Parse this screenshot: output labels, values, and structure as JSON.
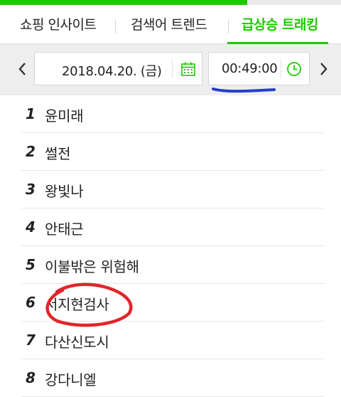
{
  "accent_color": "#1ec800",
  "annotation_color": "#e0262b",
  "underline_color": "#2340c8",
  "tabs": [
    {
      "label": "쇼핑 인사이트",
      "active": false
    },
    {
      "label": "검색어 트렌드",
      "active": false
    },
    {
      "label": "급상승 트래킹",
      "active": true
    }
  ],
  "date_bar": {
    "prev_icon": "chevron-left-icon",
    "date": "2018.04.20. (금)",
    "calendar_icon": "calendar-icon",
    "time": "00:49:00",
    "clock_icon": "clock-icon",
    "next_icon": "chevron-right-icon"
  },
  "ranking": [
    {
      "rank": "1",
      "keyword": "윤미래"
    },
    {
      "rank": "2",
      "keyword": "썰전"
    },
    {
      "rank": "3",
      "keyword": "왕빛나"
    },
    {
      "rank": "4",
      "keyword": "안태근"
    },
    {
      "rank": "5",
      "keyword": "이불밖은 위험해"
    },
    {
      "rank": "6",
      "keyword": "서지현검사"
    },
    {
      "rank": "7",
      "keyword": "다산신도시"
    },
    {
      "rank": "8",
      "keyword": "강다니엘"
    }
  ]
}
